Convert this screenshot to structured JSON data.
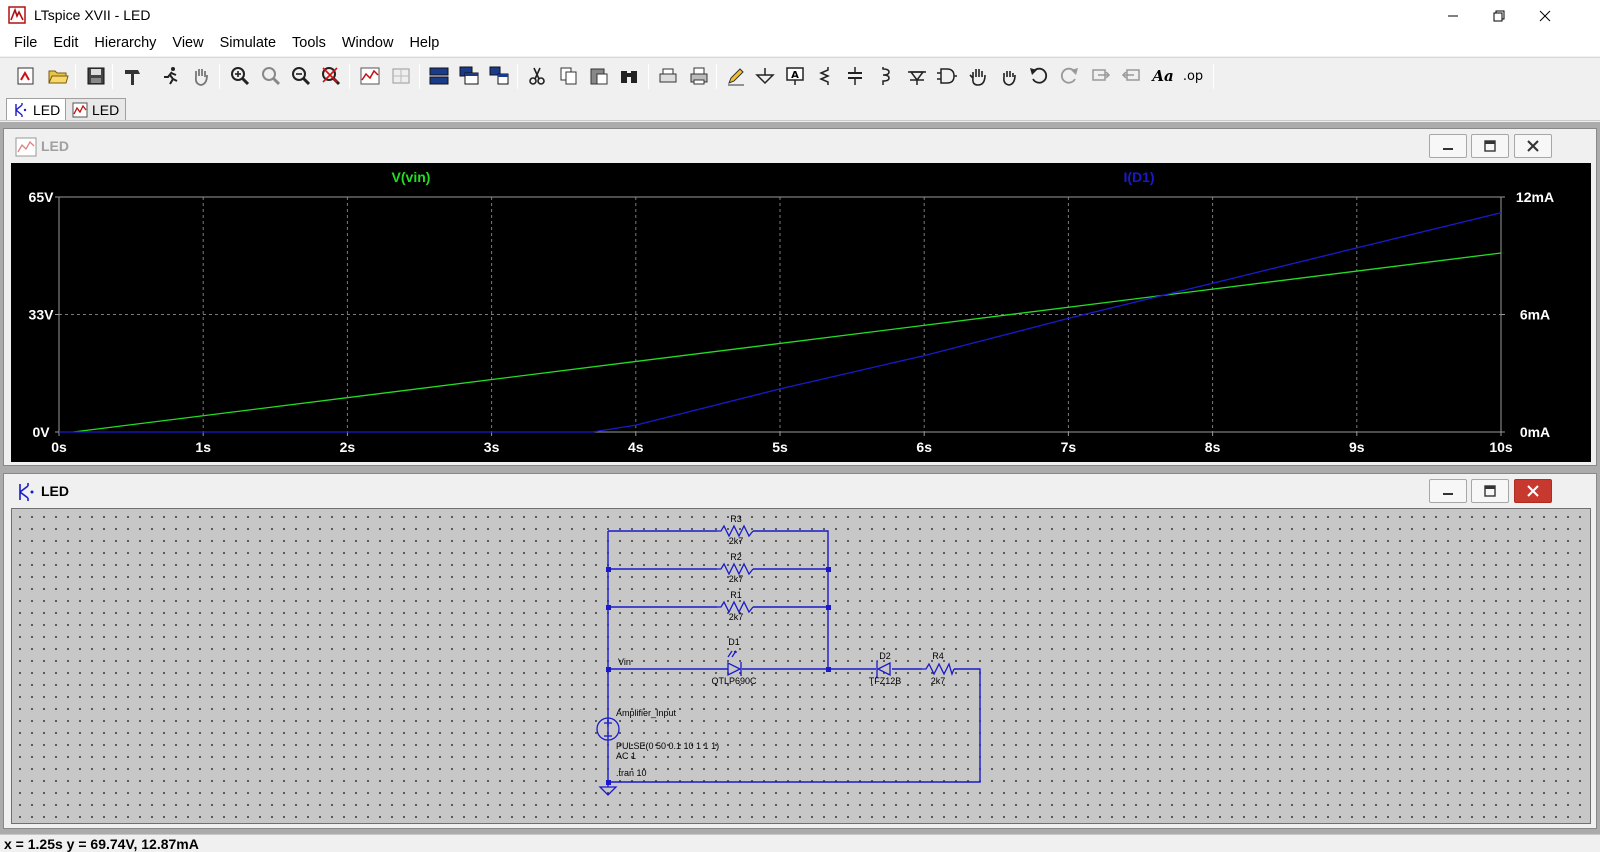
{
  "window": {
    "title": "LTspice XVII - LED",
    "minimize_icon": "minimize-icon",
    "maximize_icon": "restore-icon",
    "close_icon": "close-icon"
  },
  "menu": {
    "items": [
      "File",
      "Edit",
      "Hierarchy",
      "View",
      "Simulate",
      "Tools",
      "Window",
      "Help"
    ]
  },
  "toolbar": {
    "font_label": "Aa",
    "op_label": ".op"
  },
  "tabs": [
    {
      "label": "LED",
      "icon": "schematic-icon",
      "active": true
    },
    {
      "label": "LED",
      "icon": "waveform-icon",
      "active": false
    }
  ],
  "plot": {
    "window_title": "LED",
    "chart_data": {
      "type": "line",
      "xlabel": "",
      "x_ticks": [
        "0s",
        "1s",
        "2s",
        "3s",
        "4s",
        "5s",
        "6s",
        "7s",
        "8s",
        "9s",
        "10s"
      ],
      "xlim": [
        0,
        10
      ],
      "left_axis": {
        "ticks": [
          "0V",
          "33V",
          "65V"
        ],
        "ylim": [
          0,
          65
        ]
      },
      "right_axis": {
        "ticks": [
          "0mA",
          "6mA",
          "12mA"
        ],
        "ylim": [
          0,
          12
        ]
      },
      "grid": true,
      "series": [
        {
          "name": "V(vin)",
          "color": "#22dd22",
          "axis": "left",
          "x": [
            0.1,
            10
          ],
          "y": [
            0,
            49.5
          ]
        },
        {
          "name": "I(D1)",
          "color": "#1a1acc",
          "axis": "right",
          "x": [
            0,
            3.7,
            4.0,
            5.0,
            6.0,
            7.0,
            8.0,
            9.0,
            10.0
          ],
          "y": [
            0,
            0,
            0.35,
            2.2,
            3.9,
            5.8,
            7.6,
            9.4,
            11.2
          ]
        }
      ]
    }
  },
  "schematic": {
    "window_title": "LED",
    "components": {
      "r3": {
        "name": "R3",
        "value": "2k7"
      },
      "r2": {
        "name": "R2",
        "value": "2k7"
      },
      "r1": {
        "name": "R1",
        "value": "2k7"
      },
      "d1": {
        "name": "D1",
        "value": "QTLP690C"
      },
      "d2": {
        "name": "D2",
        "value": "TFZ12B"
      },
      "r4": {
        "name": "R4",
        "value": "2k7"
      },
      "net_vin": "Vin",
      "source_name": "Amplifier_Input",
      "source_pulse": "PULSE(0 50 0.1 10 1 1 1)",
      "source_ac": "AC 1",
      "directive": ".tran 10"
    },
    "wire_color": "#1a1acc"
  },
  "status": {
    "text": "x = 1.25s   y = 69.74V, 12.87mA"
  }
}
